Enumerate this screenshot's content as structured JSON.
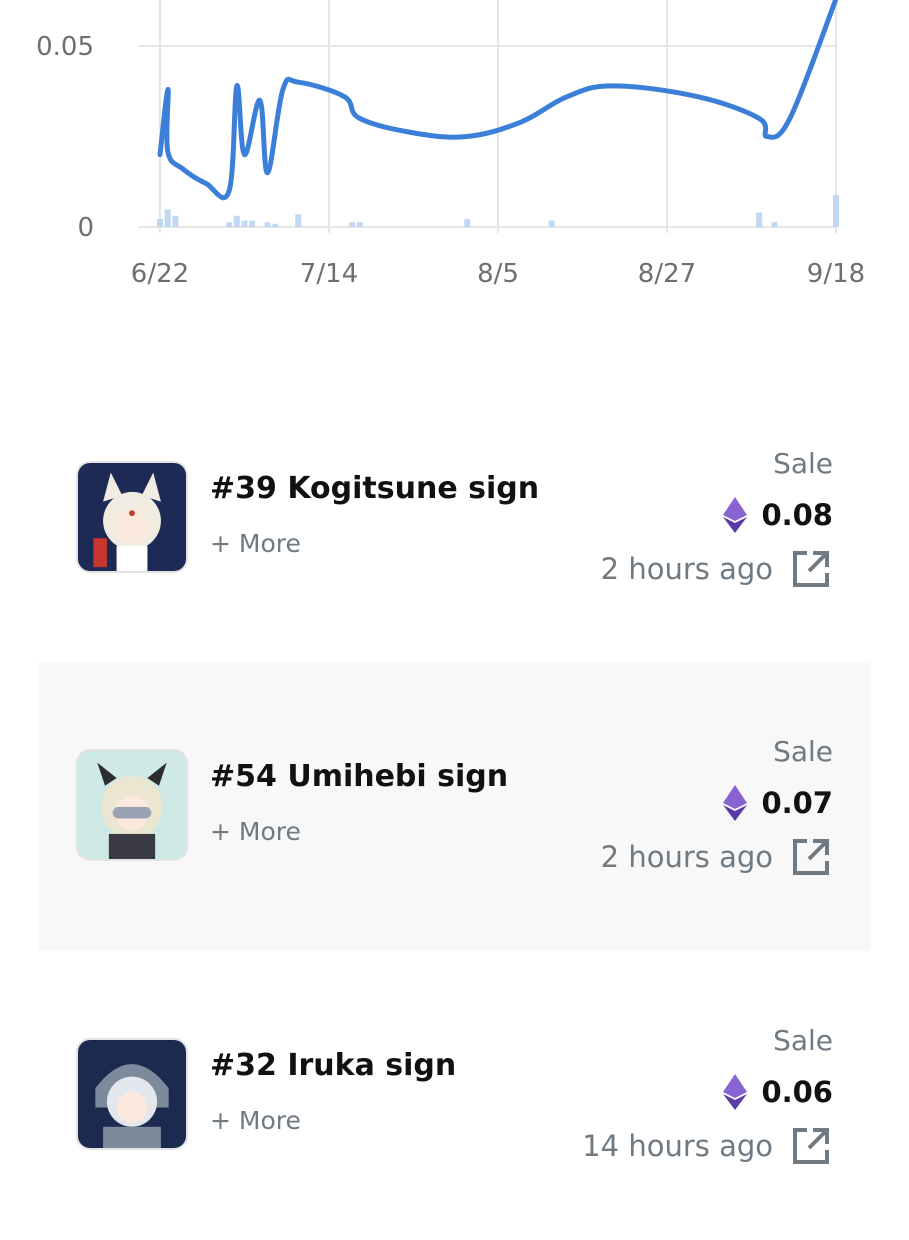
{
  "chart_data": {
    "type": "line",
    "x_tick_labels": [
      "6/22",
      "7/14",
      "8/5",
      "8/27",
      "9/18"
    ],
    "y_tick_labels": [
      "0",
      "0.05"
    ],
    "ylim": [
      0,
      0.05
    ],
    "grid": true,
    "series": [
      {
        "values": [
          {
            "x": "6/22",
            "y": 0.02
          },
          {
            "x": "6/22",
            "y": 0.038
          },
          {
            "x": "6/23",
            "y": 0.021
          },
          {
            "x": "6/25",
            "y": 0.016
          },
          {
            "x": "6/28",
            "y": 0.012
          },
          {
            "x": "7/1",
            "y": 0.01
          },
          {
            "x": "7/2",
            "y": 0.039
          },
          {
            "x": "7/3",
            "y": 0.02
          },
          {
            "x": "7/5",
            "y": 0.035
          },
          {
            "x": "7/6",
            "y": 0.015
          },
          {
            "x": "7/8",
            "y": 0.038
          },
          {
            "x": "7/10",
            "y": 0.04
          },
          {
            "x": "7/16",
            "y": 0.036
          },
          {
            "x": "7/18",
            "y": 0.03
          },
          {
            "x": "7/25",
            "y": 0.026
          },
          {
            "x": "8/1",
            "y": 0.025
          },
          {
            "x": "8/8",
            "y": 0.029
          },
          {
            "x": "8/14",
            "y": 0.036
          },
          {
            "x": "8/20",
            "y": 0.039
          },
          {
            "x": "8/31",
            "y": 0.036
          },
          {
            "x": "9/8",
            "y": 0.03
          },
          {
            "x": "9/9",
            "y": 0.025
          },
          {
            "x": "9/12",
            "y": 0.03
          },
          {
            "x": "9/18",
            "y": 0.063
          }
        ]
      },
      {
        "type": "bar",
        "volume_ratio": [
          {
            "x": "6/22",
            "v": 0.25
          },
          {
            "x": "6/23",
            "v": 0.55
          },
          {
            "x": "6/24",
            "v": 0.35
          },
          {
            "x": "7/1",
            "v": 0.15
          },
          {
            "x": "7/2",
            "v": 0.35
          },
          {
            "x": "7/3",
            "v": 0.2
          },
          {
            "x": "7/4",
            "v": 0.2
          },
          {
            "x": "7/6",
            "v": 0.15
          },
          {
            "x": "7/7",
            "v": 0.1
          },
          {
            "x": "7/10",
            "v": 0.4
          },
          {
            "x": "7/17",
            "v": 0.15
          },
          {
            "x": "7/18",
            "v": 0.15
          },
          {
            "x": "8/1",
            "v": 0.25
          },
          {
            "x": "8/12",
            "v": 0.2
          },
          {
            "x": "9/8",
            "v": 0.45
          },
          {
            "x": "9/10",
            "v": 0.15
          },
          {
            "x": "9/18",
            "v": 1.0
          }
        ]
      }
    ]
  },
  "activity": [
    {
      "name": "#39 Kogitsune sign",
      "more": "+ More",
      "event": "Sale",
      "price": "0.08",
      "time": "2 hours ago",
      "thumb_colors": {
        "bg": "#1d2a55",
        "hair": "#f1ece2",
        "accent": "#c8372d"
      }
    },
    {
      "name": "#54 Umihebi sign",
      "more": "+ More",
      "event": "Sale",
      "price": "0.07",
      "time": "2 hours ago",
      "thumb_colors": {
        "bg": "#cfe9e6",
        "hair": "#ebe6cf",
        "accent": "#3a3a44"
      }
    },
    {
      "name": "#32 Iruka sign",
      "more": "+ More",
      "event": "Sale",
      "price": "0.06",
      "time": "14 hours ago",
      "thumb_colors": {
        "bg": "#1b2a4e",
        "hair": "#e3e7ee",
        "accent": "#7d8a9c"
      }
    }
  ],
  "colors": {
    "line": "#3b7fd9",
    "bar": "#c2d8f2",
    "grid": "#e6e6e6",
    "eth_top": "#8a63d2",
    "eth_bottom": "#5b3aa6"
  },
  "icons": {
    "eth": "ethereum-icon",
    "external": "external-link-icon"
  }
}
